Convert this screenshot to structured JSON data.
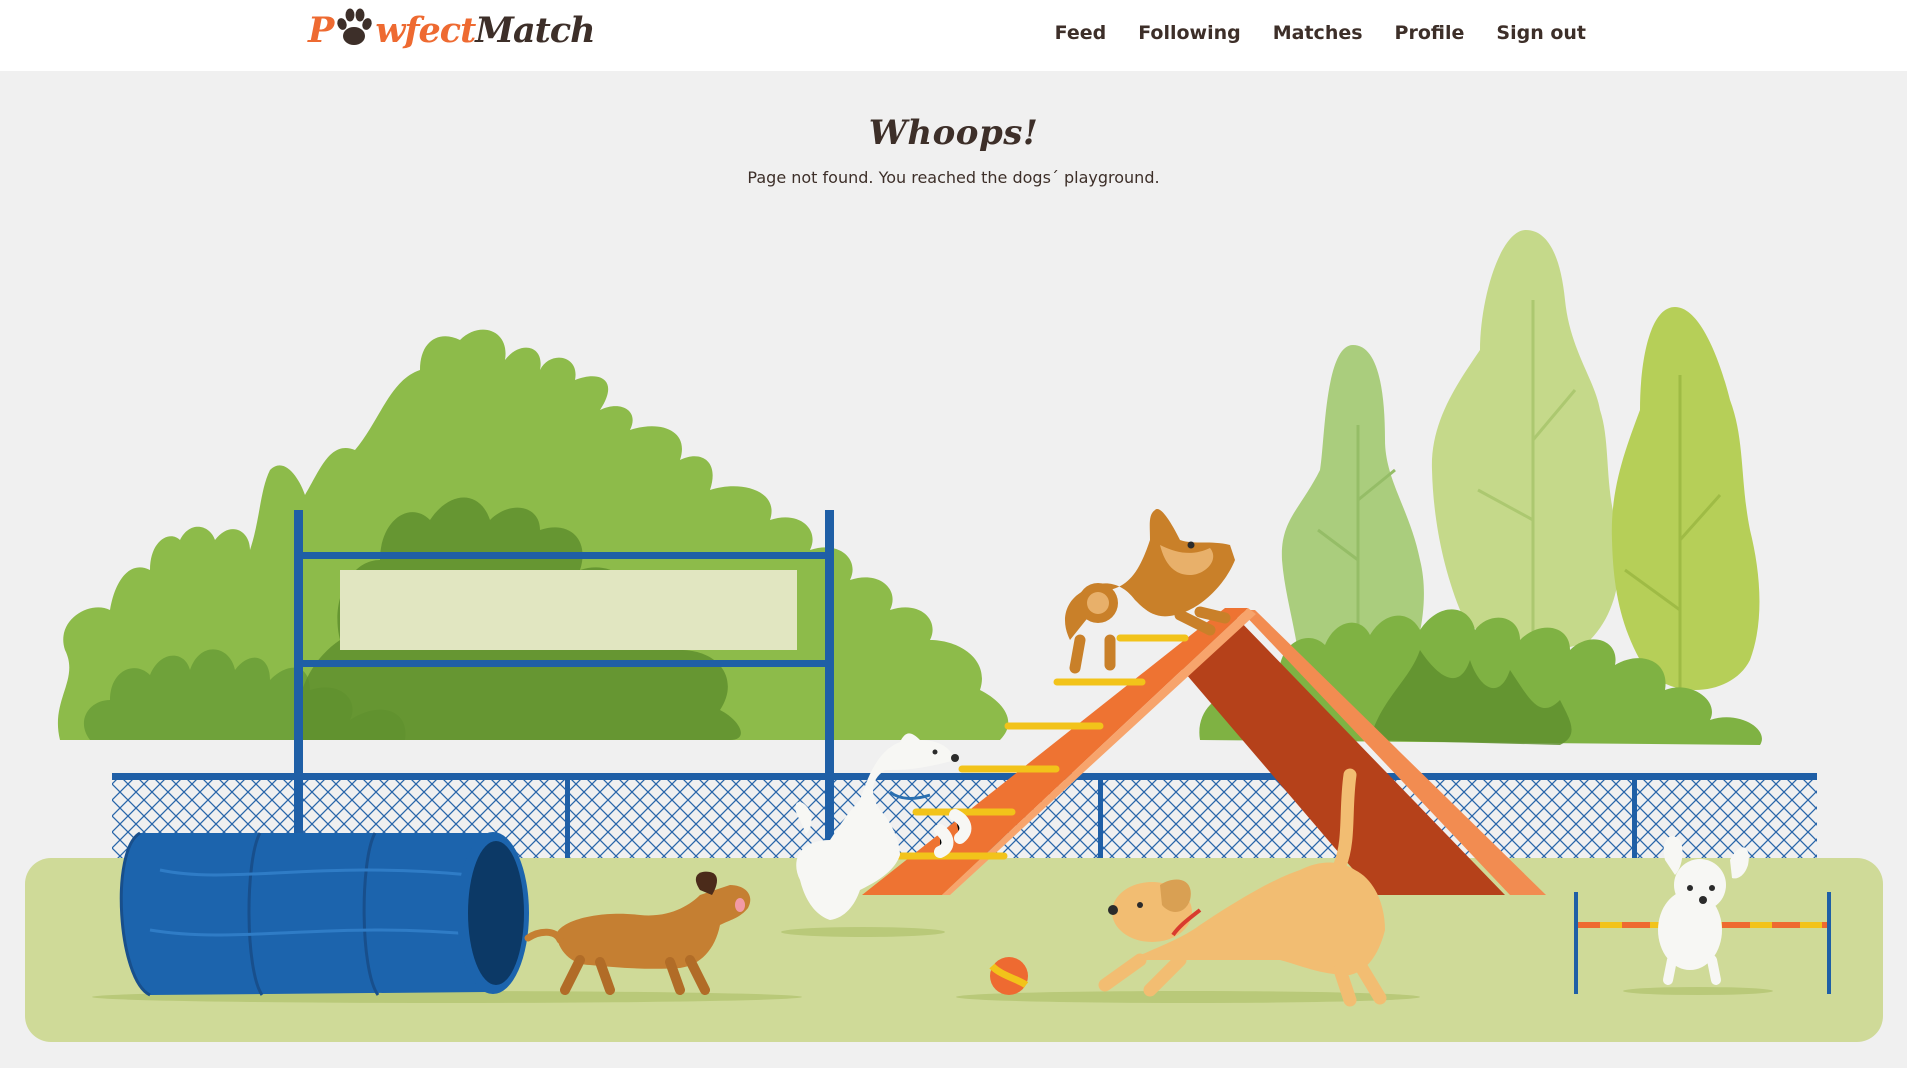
{
  "header": {
    "brand": {
      "part1": "P",
      "part2": "wfect",
      "part3": "Match"
    },
    "nav": [
      "Feed",
      "Following",
      "Matches",
      "Profile",
      "Sign out"
    ]
  },
  "main": {
    "title": "Whoops!",
    "message": "Page not found. You reached the dogs´ playground."
  },
  "illustration": {
    "subject": "dogs-playground-icon"
  },
  "colors": {
    "brand_orange": "#ee6a31",
    "brand_dark": "#3d2f29",
    "background": "#f0f0f0",
    "ground": "#cfda98",
    "fence_blue": "#1f5fa6"
  }
}
